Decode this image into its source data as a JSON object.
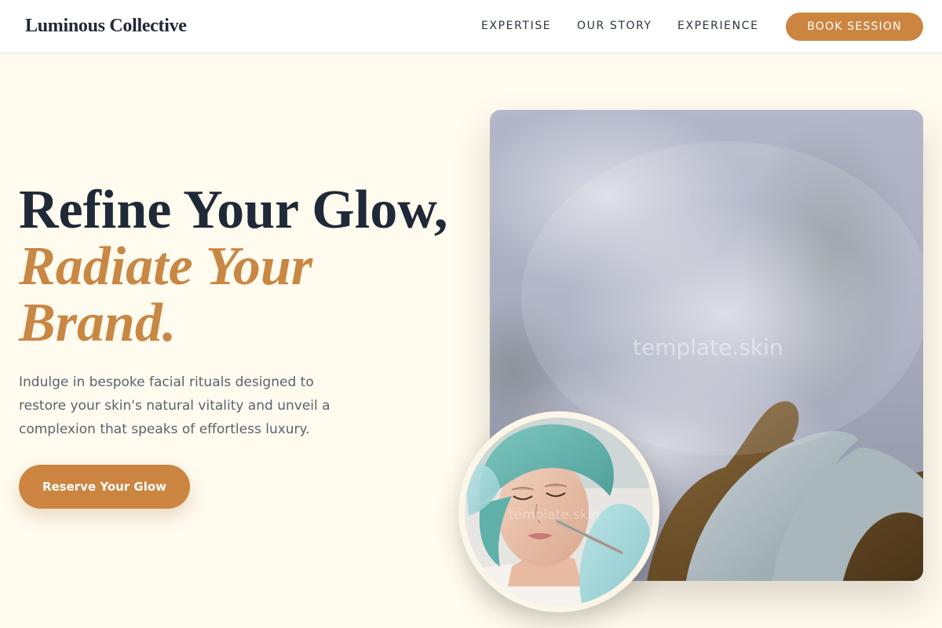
{
  "header": {
    "brand": "Luminous Collective",
    "nav": [
      {
        "label": "EXPERTISE"
      },
      {
        "label": "OUR STORY"
      },
      {
        "label": "EXPERIENCE"
      }
    ],
    "cta_label": "BOOK SESSION"
  },
  "hero": {
    "line1": "Refine Your Glow,",
    "line2": "Radiate Your",
    "line3": "Brand.",
    "description": "Indulge in bespoke facial rituals designed to restore your skin's natural vitality and unveil a complexion that speaks of effortless luxury.",
    "cta_label": "Reserve Your Glow"
  },
  "media": {
    "main_watermark": "template.skin",
    "circle_watermark": "template.skin"
  },
  "colors": {
    "accent": "#cc8540",
    "background": "#fffbef",
    "heading": "#1f2937",
    "body_text": "#5b6270"
  }
}
